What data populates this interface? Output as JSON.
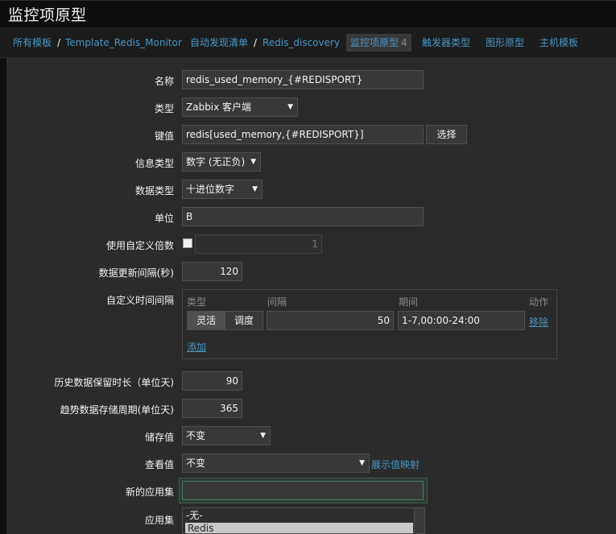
{
  "header": {
    "title": "监控项原型"
  },
  "breadcrumb": {
    "all_templates": "所有模板",
    "template": "Template_Redis_Monitor",
    "discovery_list": "自动发现清单",
    "discovery_rule": "Redis_discovery",
    "sep": "/",
    "tabs": {
      "item_prototypes": "监控项原型",
      "item_prototypes_count": "4",
      "trigger_prototypes": "触发器类型",
      "graph_prototypes": "图形原型",
      "host_prototypes": "主机模板"
    }
  },
  "form": {
    "name": {
      "label": "名称",
      "value": "redis_used_memory_{#REDISPORT}"
    },
    "type": {
      "label": "类型",
      "value": "Zabbix 客户端"
    },
    "key": {
      "label": "键值",
      "value": "redis[used_memory,{#REDISPORT}]",
      "button": "选择"
    },
    "info_type": {
      "label": "信息类型",
      "value": "数字 (无正负)"
    },
    "data_type": {
      "label": "数据类型",
      "value": "十进位数字"
    },
    "units": {
      "label": "单位",
      "value": "B"
    },
    "custom_multiplier": {
      "label": "使用自定义倍数",
      "value": "1"
    },
    "update_interval": {
      "label": "数据更新间隔(秒)",
      "value": "120"
    },
    "custom_intervals": {
      "label": "自定义时间间隔",
      "headers": {
        "type": "类型",
        "interval": "间隔",
        "period": "期间",
        "action": "动作"
      },
      "row": {
        "flexible": "灵活",
        "scheduling": "调度",
        "interval": "50",
        "period": "1-7,00:00-24:00",
        "remove": "移除"
      },
      "add": "添加"
    },
    "history": {
      "label": "历史数据保留时长（单位天)",
      "value": "90"
    },
    "trends": {
      "label": "趋势数据存储周期(单位天)",
      "value": "365"
    },
    "store_value": {
      "label": "储存值",
      "value": "不变"
    },
    "show_value": {
      "label": "查看值",
      "value": "不变",
      "link": "展示值映射"
    },
    "new_application": {
      "label": "新的应用集",
      "value": ""
    },
    "applications": {
      "label": "应用集",
      "options": [
        "-无-",
        "Redis"
      ]
    }
  }
}
